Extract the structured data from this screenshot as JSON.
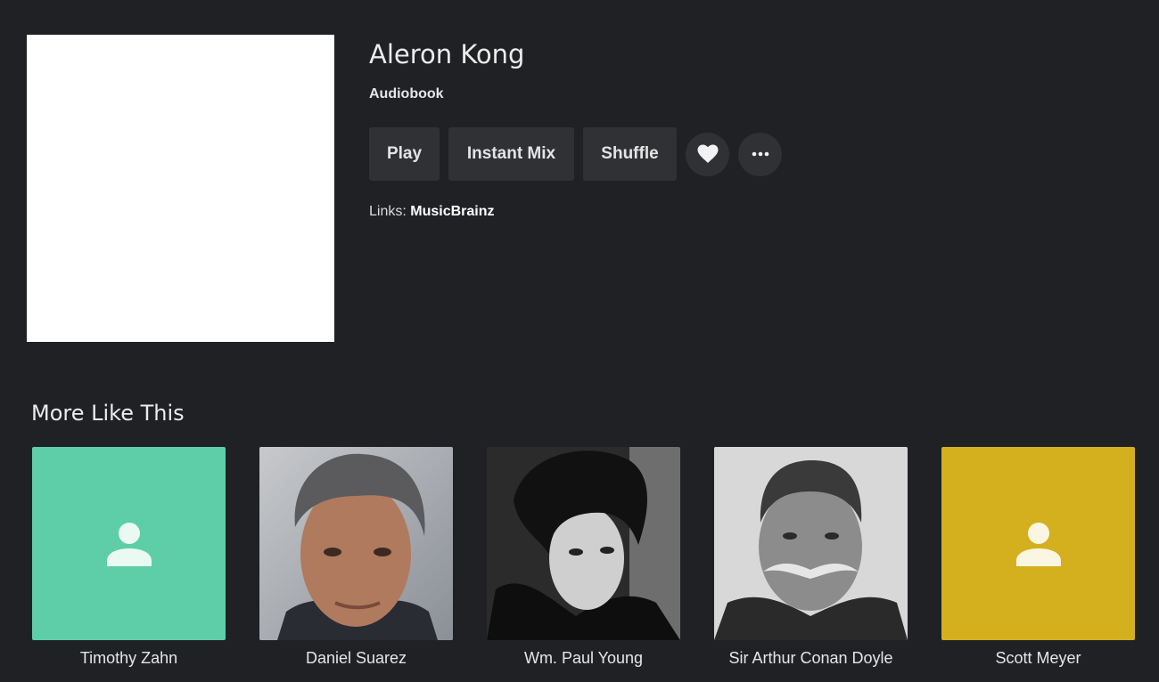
{
  "artist": {
    "name": "Aleron Kong",
    "type": "Audiobook"
  },
  "actions": {
    "play": "Play",
    "instant_mix": "Instant Mix",
    "shuffle": "Shuffle",
    "favorite_icon": "heart-icon",
    "more_icon": "more-horizontal-icon"
  },
  "links": {
    "prefix": "Links:",
    "musicbrainz": "MusicBrainz"
  },
  "more_like_this": {
    "title": "More Like This",
    "items": [
      {
        "name": "Timothy Zahn",
        "image": "placeholder",
        "color": "#5dcea7"
      },
      {
        "name": "Daniel Suarez",
        "image": "photo"
      },
      {
        "name": "Wm. Paul Young",
        "image": "photo"
      },
      {
        "name": "Sir Arthur Conan Doyle",
        "image": "photo"
      },
      {
        "name": "Scott Meyer",
        "image": "placeholder",
        "color": "#d4b01e"
      }
    ]
  },
  "colors": {
    "background": "#202125",
    "button": "#303135",
    "teal_placeholder": "#5dcea7",
    "gold_placeholder": "#d4b01e"
  }
}
